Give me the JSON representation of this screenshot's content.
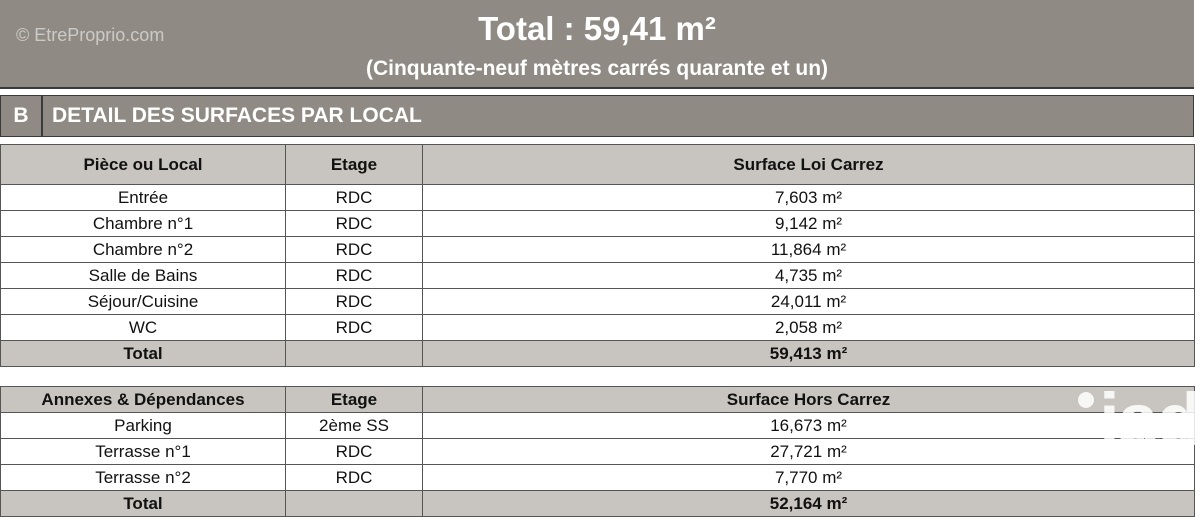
{
  "watermark": "© EtreProprio.com",
  "summary": {
    "title": "Total : 59,41 m²",
    "subtitle": "(Cinquante-neuf mètres carrés quarante et un)"
  },
  "section": {
    "letter": "B",
    "heading": "DETAIL DES SURFACES PAR LOCAL"
  },
  "table_main": {
    "headers": [
      "Pièce ou Local",
      "Etage",
      "Surface Loi Carrez"
    ],
    "rows": [
      [
        "Entrée",
        "RDC",
        "7,603 m²"
      ],
      [
        "Chambre n°1",
        "RDC",
        "9,142 m²"
      ],
      [
        "Chambre n°2",
        "RDC",
        "11,864 m²"
      ],
      [
        "Salle de Bains",
        "RDC",
        "4,735 m²"
      ],
      [
        "Séjour/Cuisine",
        "RDC",
        "24,011 m²"
      ],
      [
        "WC",
        "RDC",
        "2,058 m²"
      ]
    ],
    "total": [
      "Total",
      "",
      "59,413 m²"
    ]
  },
  "table_annexes": {
    "headers": [
      "Annexes & Dépendances",
      "Etage",
      "Surface Hors Carrez"
    ],
    "rows": [
      [
        "Parking",
        "2ème SS",
        "16,673 m²"
      ],
      [
        "Terrasse n°1",
        "RDC",
        "27,721 m²"
      ],
      [
        "Terrasse n°2",
        "RDC",
        "7,770 m²"
      ]
    ],
    "total": [
      "Total",
      "",
      "52,164 m²"
    ]
  },
  "logo": {
    "text": "iad",
    "icon": "iad-logo-icon"
  }
}
